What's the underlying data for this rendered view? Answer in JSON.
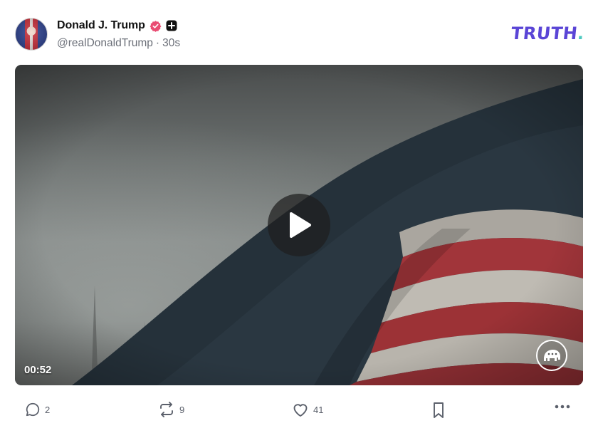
{
  "post": {
    "author": {
      "display_name": "Donald J. Trump",
      "handle": "@realDonaldTrump",
      "separator": "·",
      "time_ago": "30s"
    },
    "brand": {
      "logo_text": "TRUTH",
      "logo_dot": ".",
      "colors": {
        "primary": "#5a45d6",
        "accent": "#4ec9c0"
      }
    },
    "media": {
      "type": "video",
      "duration": "00:52"
    },
    "actions": {
      "replies": "2",
      "retruths": "9",
      "likes": "41"
    },
    "icons": {
      "verified": "verified-badge-icon",
      "plus": "plus-badge-icon",
      "play": "play-icon",
      "corner": "elephant-logo-icon",
      "reply": "speech-bubble-icon",
      "retruth": "repost-icon",
      "like": "heart-icon",
      "bookmark": "bookmark-icon",
      "more": "more-dots-icon"
    }
  }
}
